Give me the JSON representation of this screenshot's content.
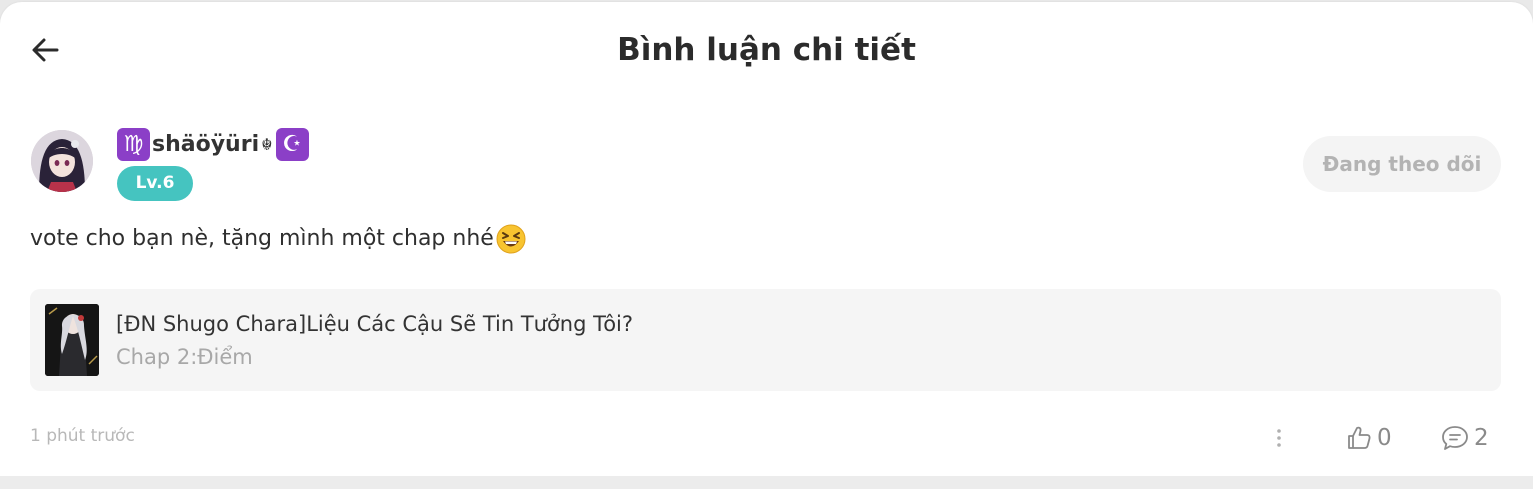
{
  "header": {
    "title": "Bình luận chi tiết",
    "back_icon": "arrow-left-icon"
  },
  "comment": {
    "user": {
      "name": "shäöÿüri",
      "prefix_sign": "♍",
      "inline_symbol": "☬",
      "suffix_sign": "☪",
      "level": "Lv.6",
      "follow_label": "Đang theo dõi"
    },
    "text": "vote cho bạn nè, tặng mình một chap nhé",
    "emoji": "grinning-squinting-face-icon",
    "story": {
      "title": "[ĐN Shugo Chara]Liệu Các Cậu Sẽ Tin Tưởng Tôi?",
      "chapter": "Chap 2:Điểm"
    },
    "timestamp": "1 phút trước",
    "likes": "0",
    "replies": "2"
  },
  "colors": {
    "level_badge": "#45c4c0",
    "sign_bg": "#8b3fc7",
    "follow_bg": "#f4f4f4",
    "follow_text": "#b3b3b3",
    "card_bg": "#f5f5f5"
  }
}
